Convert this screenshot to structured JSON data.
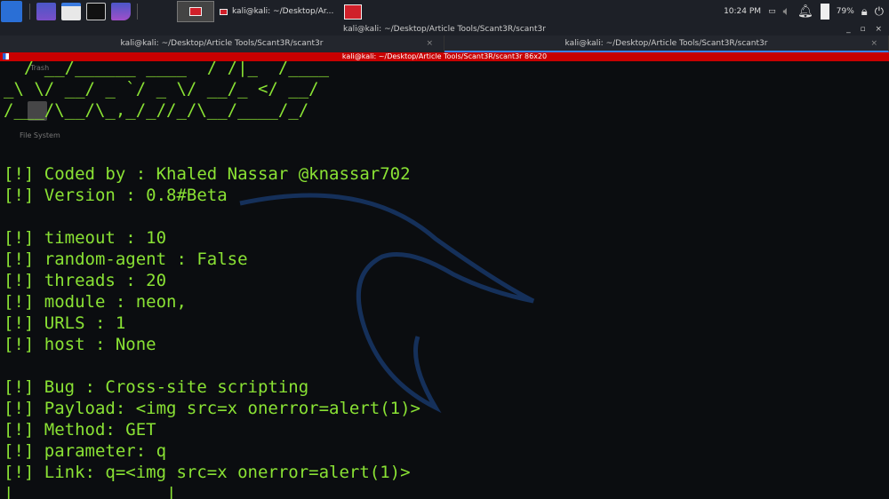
{
  "taskbar": {
    "task_title": "kali@kali: ~/Desktop/Ar...",
    "clock": "10:24 PM",
    "battery": "79%"
  },
  "window": {
    "title": "kali@kali: ~/Desktop/Article Tools/Scant3R/scant3r",
    "controls": "_ ▫ ×"
  },
  "tabs": [
    {
      "label": "kali@kali: ~/Desktop/Article Tools/Scant3R/scant3r",
      "close": "×"
    },
    {
      "label": "kali@kali: ~/Desktop/Article Tools/Scant3R/scant3r",
      "close": "×"
    }
  ],
  "terminal_title": "kali@kali: ~/Desktop/Article Tools/Scant3R/scant3r 86x20",
  "desktop": {
    "icons": [
      "Trash",
      "File System"
    ]
  },
  "colors": {
    "terminal_text": "#8ae234",
    "title_bar": "#c80000",
    "accent": "#3b82f6"
  },
  "output": {
    "banner": [
      "  / __/______ ____  / /|_  /____",
      "_\\ \\/ __/ _ `/ _ \\/ __/_ </ __/",
      "/___/\\__/\\_,_/_//_/\\__/____/_/"
    ],
    "lines": [
      "",
      "",
      "[!] Coded by : Khaled Nassar @knassar702",
      "[!] Version : 0.8#Beta",
      "",
      "[!] timeout : 10",
      "[!] random-agent : False",
      "[!] threads : 20",
      "[!] module : neon,",
      "[!] URLS : 1",
      "[!] host : None",
      "",
      "[!] Bug : Cross-site scripting",
      "[!] Payload: <img src=x onerror=alert(1)>",
      "[!] Method: GET",
      "[!] parameter: q",
      "[!] Link: q=<img src=x onerror=alert(1)>",
      "|_______________|"
    ]
  }
}
